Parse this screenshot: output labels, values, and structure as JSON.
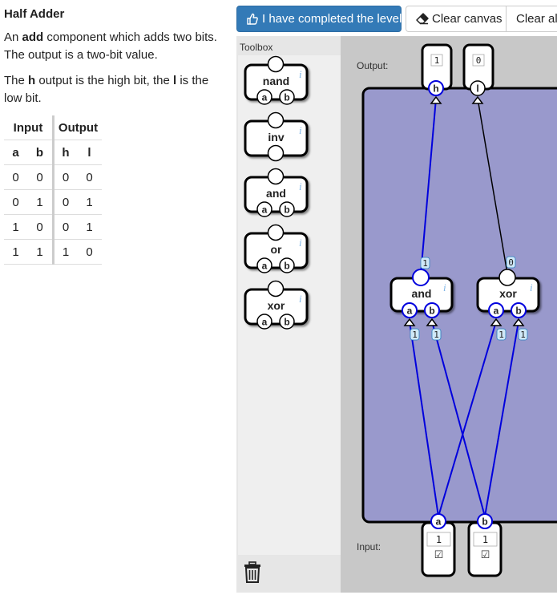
{
  "level": {
    "title": "Half Adder",
    "p1_pre": "An ",
    "p1_bold": "add",
    "p1_post": " component which adds two bits. The output is a two-bit value.",
    "p2_pre": "The ",
    "p2_bold1": "h",
    "p2_mid": " output is the high bit, the ",
    "p2_bold2": "l",
    "p2_post": " is the low bit."
  },
  "truth_table": {
    "group_input": "Input",
    "group_output": "Output",
    "columns": [
      "a",
      "b",
      "h",
      "l"
    ],
    "rows": [
      [
        "0",
        "0",
        "0",
        "0"
      ],
      [
        "0",
        "1",
        "0",
        "1"
      ],
      [
        "1",
        "0",
        "0",
        "1"
      ],
      [
        "1",
        "1",
        "1",
        "0"
      ]
    ]
  },
  "buttons": {
    "complete": "I have completed the level",
    "clear_canvas": "Clear canvas",
    "clear_all": "Clear all"
  },
  "toolbox": {
    "title": "Toolbox",
    "items": [
      "nand",
      "inv",
      "and",
      "or",
      "xor"
    ],
    "pin_a": "a",
    "pin_b": "b",
    "info": "i"
  },
  "canvas": {
    "output_label": "Output:",
    "input_label": "Input:",
    "outputs": [
      {
        "name": "h",
        "value": "1"
      },
      {
        "name": "l",
        "value": "0"
      }
    ],
    "inputs": [
      {
        "name": "a",
        "value": "1",
        "checkbox": "☑"
      },
      {
        "name": "b",
        "value": "1",
        "checkbox": "☑"
      }
    ],
    "gates": [
      {
        "name": "and",
        "out_value": "1",
        "in_a_value": "1",
        "in_b_value": "1"
      },
      {
        "name": "xor",
        "out_value": "0",
        "in_a_value": "1",
        "in_b_value": "1"
      }
    ],
    "pin_a": "a",
    "pin_b": "b"
  },
  "colors": {
    "primary": "#337ab7",
    "canvas_bg": "#c8c8c8",
    "board": "#9999cc",
    "wire_active": "#0000dd",
    "wire_inactive": "#000000",
    "value_badge": "#cfe8f7"
  },
  "icons": {
    "complete": "thumbs-up-icon",
    "clear": "eraser-icon",
    "trash": "trash-icon",
    "info": "info-icon"
  }
}
